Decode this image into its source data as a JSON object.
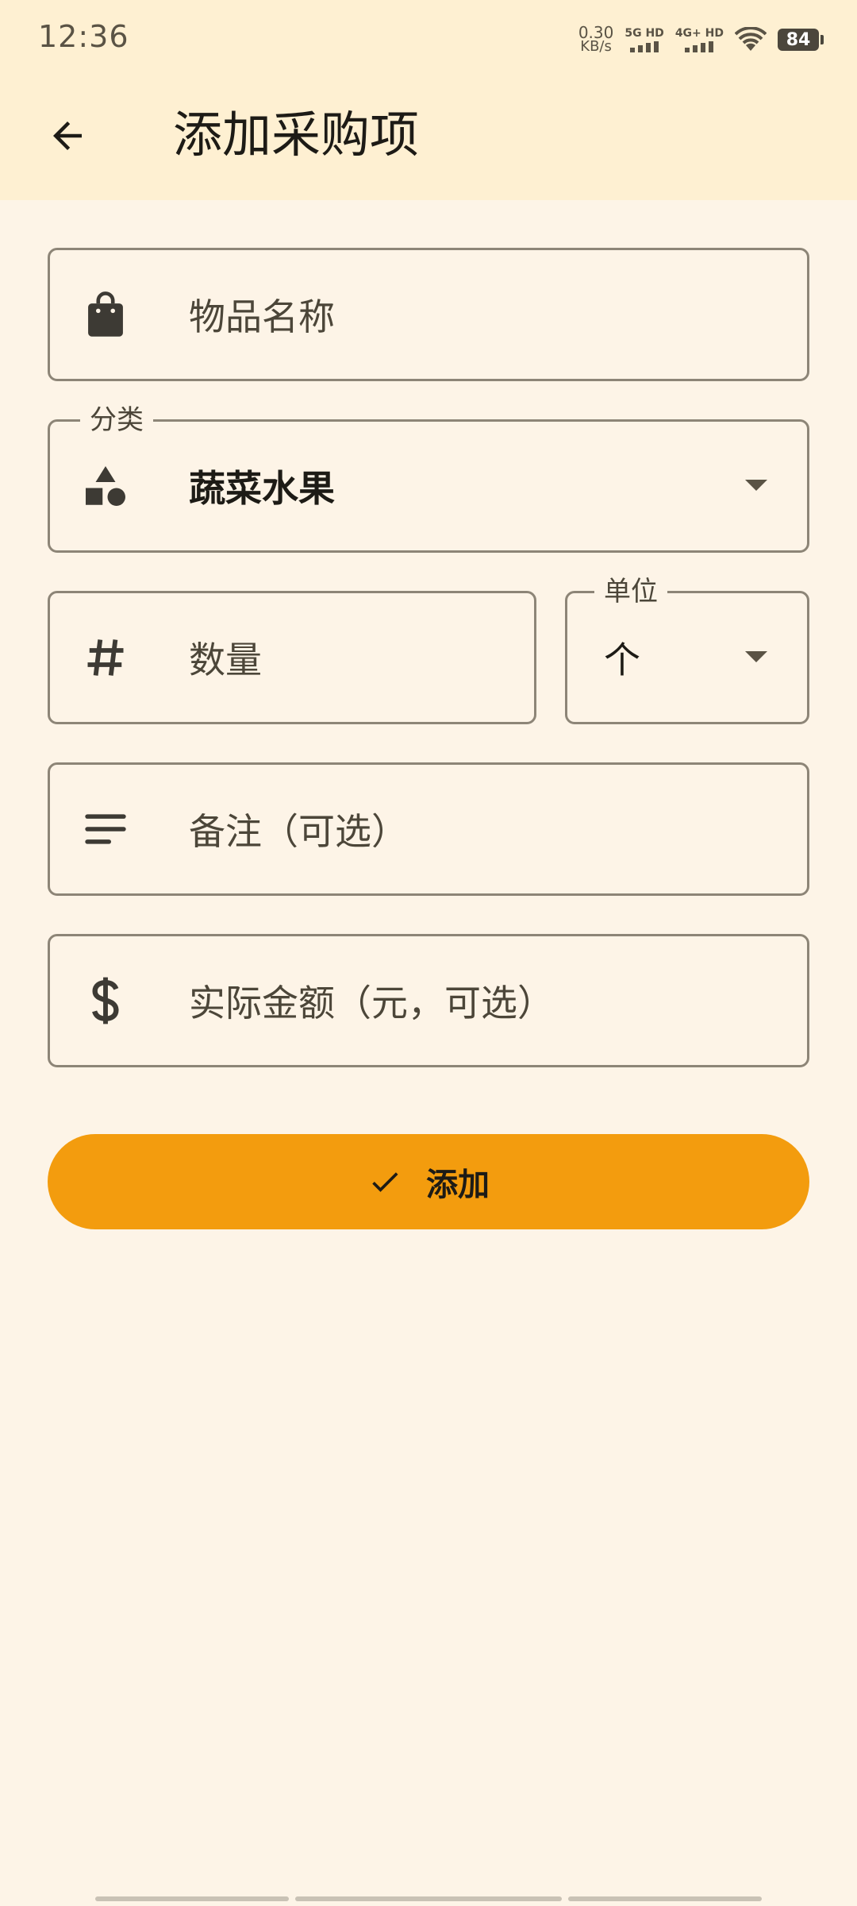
{
  "status_bar": {
    "time": "12:36",
    "net_speed_value": "0.30",
    "net_speed_unit": "KB/s",
    "signal1_label": "5G HD",
    "signal2_label": "4G+ HD",
    "battery": "84"
  },
  "app_bar": {
    "title": "添加采购项",
    "back_icon": "arrow-back-icon"
  },
  "form": {
    "item_name": {
      "placeholder": "物品名称",
      "icon": "shopping-bag-icon"
    },
    "category": {
      "label": "分类",
      "value": "蔬菜水果",
      "icon": "category-shapes-icon"
    },
    "quantity": {
      "placeholder": "数量",
      "icon": "hash-icon"
    },
    "unit": {
      "label": "单位",
      "value": "个"
    },
    "note": {
      "placeholder": "备注（可选）",
      "icon": "notes-icon"
    },
    "amount": {
      "placeholder": "实际金额（元，可选）",
      "icon": "dollar-icon"
    }
  },
  "add_button": {
    "label": "添加",
    "icon": "check-icon"
  },
  "colors": {
    "app_bar_bg": "#FEF0D2",
    "page_bg": "#FDF4E7",
    "accent": "#F39C0E",
    "outline": "#8d8577"
  }
}
